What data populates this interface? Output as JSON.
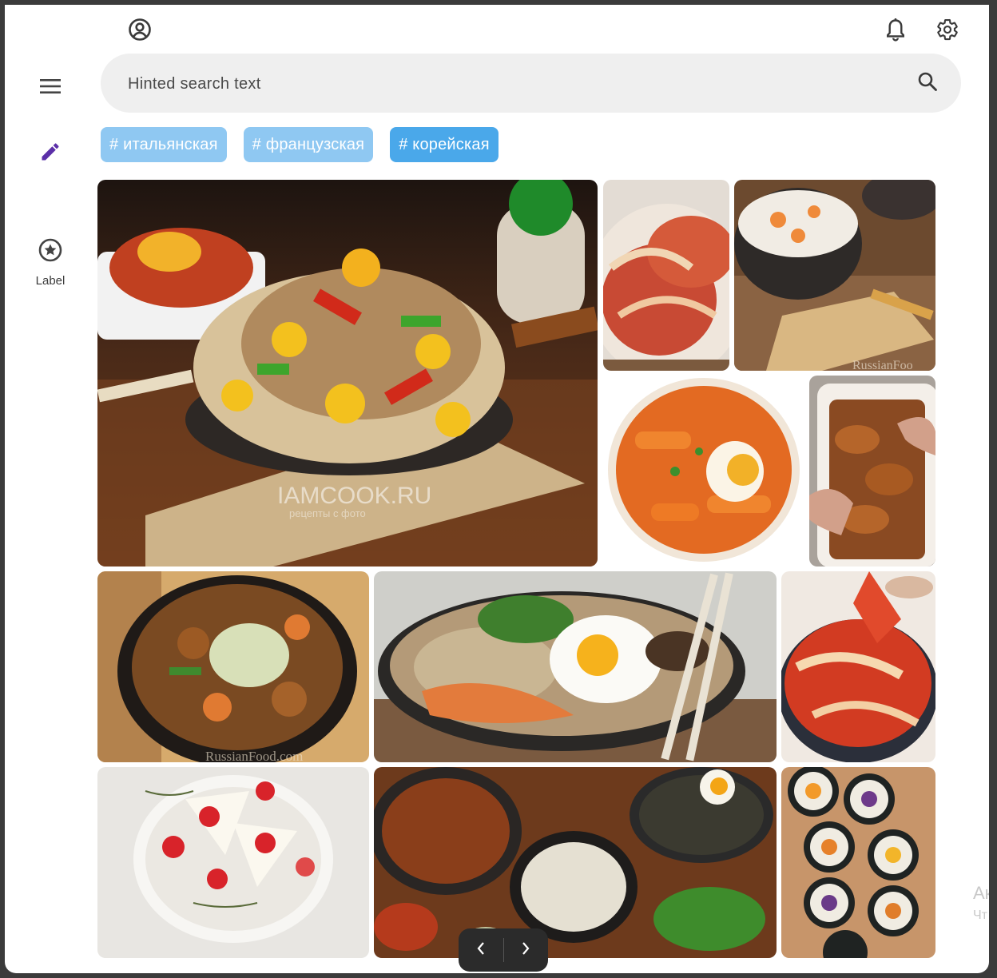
{
  "search": {
    "placeholder": "Hinted search text"
  },
  "rail": {
    "items": [
      {
        "icon": "menu-icon"
      },
      {
        "icon": "edit-pencil-icon",
        "color": "#5b2fa8"
      },
      {
        "icon": "star-circle-icon",
        "label": "Label"
      }
    ]
  },
  "header": {
    "account_icon": "account-circle-icon",
    "notification_icon": "bell-icon",
    "settings_icon": "gear-icon"
  },
  "chips": [
    {
      "label": "# итальянская"
    },
    {
      "label": "# французская"
    },
    {
      "label": "# корейская"
    }
  ],
  "gallery": {
    "images": [
      {
        "alt": "japchae glass noodles bowl",
        "watermark": "IAMCOOK.RU",
        "watermark_sub": "рецепты с фото"
      },
      {
        "alt": "napa cabbage kimchi"
      },
      {
        "alt": "white kimchi bowl",
        "watermark": "RussianFoo"
      },
      {
        "alt": "tteokbokki with egg"
      },
      {
        "alt": "korean chicken wings"
      },
      {
        "alt": "korean stew in pot",
        "watermark": "RussianFood.com"
      },
      {
        "alt": "bibimbap with fried egg"
      },
      {
        "alt": "kimchi closeup"
      },
      {
        "alt": "strawberry sandwiches"
      },
      {
        "alt": "korean table spread"
      },
      {
        "alt": "kimbap rolls"
      }
    ]
  },
  "pager": {
    "prev_icon": "chevron-left-icon",
    "next_icon": "chevron-right-icon"
  },
  "overlay": {
    "line1": "Ак",
    "line2": "Чт"
  }
}
